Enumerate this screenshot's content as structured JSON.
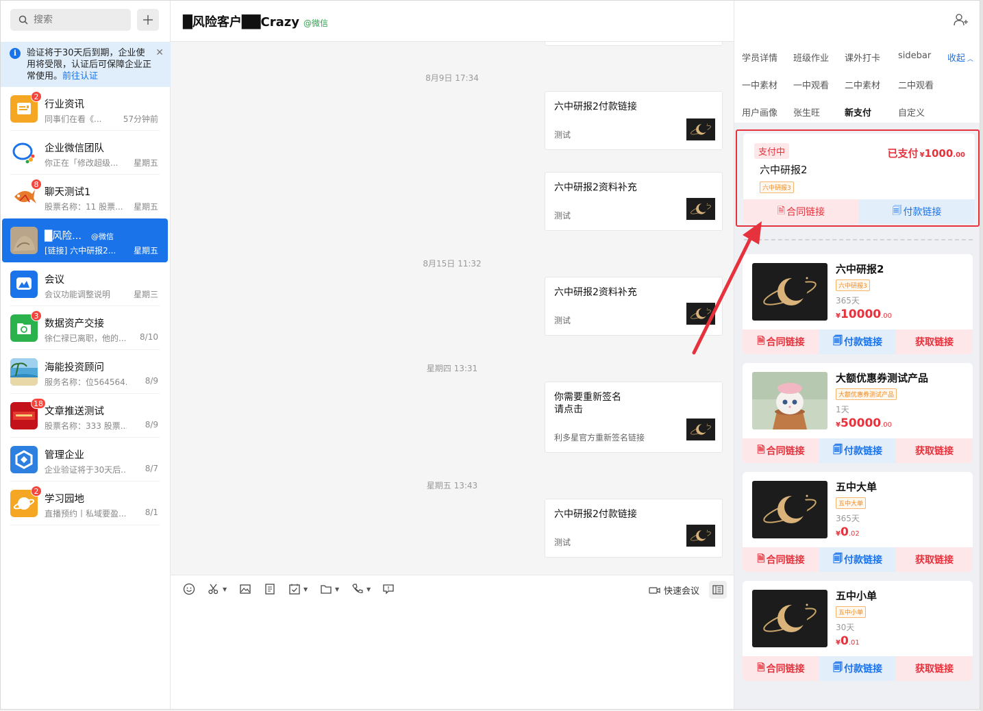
{
  "search": {
    "placeholder": "搜索"
  },
  "notice": {
    "text": "验证将于30天后到期，企业使用将受限，认证后可保障企业正常使用。",
    "link": "前往认证"
  },
  "conversations": [
    {
      "name": "行业资讯",
      "preview": "同事们在看《...",
      "time": "57分钟前",
      "badge": "2",
      "avatar": "news"
    },
    {
      "name": "企业微信团队",
      "preview": "你正在「修改超级...",
      "time": "星期五",
      "badge": "",
      "avatar": "wecom"
    },
    {
      "name": "聊天测试1",
      "preview": "股票名称：11 股票...",
      "time": "星期五",
      "badge": "8",
      "avatar": "fish"
    },
    {
      "name": "█风险...",
      "tag": "@微信",
      "preview": "[链接] 六中研报2...",
      "time": "星期五",
      "badge": "",
      "avatar": "photo"
    },
    {
      "name": "会议",
      "preview": "会议功能调整说明",
      "time": "星期三",
      "badge": "",
      "avatar": "meeting"
    },
    {
      "name": "数据资产交接",
      "preview": "徐仁禄已离职，他的...",
      "time": "8/10",
      "badge": "3",
      "avatar": "data"
    },
    {
      "name": "海能投资顾问",
      "preview": "服务名称：位564564...",
      "time": "8/9",
      "badge": "",
      "avatar": "beach"
    },
    {
      "name": "文章推送测试",
      "preview": "股票名称：333 股票...",
      "time": "8/9",
      "badge": "18",
      "avatar": "red"
    },
    {
      "name": "管理企业",
      "preview": "企业验证将于30天后...",
      "time": "8/7",
      "badge": "",
      "avatar": "manage"
    },
    {
      "name": "学习园地",
      "preview": "直播预约丨私域要盈...",
      "time": "8/1",
      "badge": "2",
      "avatar": "study"
    }
  ],
  "chat": {
    "title": "█风险客户██Crazy",
    "title_tag": "@微信",
    "timestamps": [
      "8月9日 17:34",
      "8月15日 11:32",
      "星期四 13:31",
      "星期五 13:43"
    ],
    "cards": [
      {
        "title": "六中研报2付款链接",
        "desc": "测试"
      },
      {
        "title": "六中研报2资料补充",
        "desc": "测试"
      },
      {
        "title": "六中研报2资料补充",
        "desc": "测试"
      },
      {
        "title": "你需要重新签名\n请点击",
        "desc": "利多星官方重新签名链接"
      },
      {
        "title": "六中研报2付款链接",
        "desc": "测试"
      }
    ],
    "quick_meeting": "快速会议"
  },
  "sidebar_tabs": {
    "row1": [
      "学员详情",
      "班级作业",
      "课外打卡",
      "sidebar"
    ],
    "collapse": "收起",
    "row2": [
      "一中素材",
      "一中观看",
      "二中素材",
      "二中观看"
    ],
    "row3": [
      "用户画像",
      "张生旺",
      "新支付",
      "自定义"
    ],
    "active": "新支付"
  },
  "current_order": {
    "status": "支付中",
    "product": "六中研报2",
    "tag": "六中研报3",
    "paid_label": "已支付",
    "currency": "¥",
    "amount_int": "1000",
    "amount_dec": ".00",
    "contract_btn": "合同链接",
    "pay_btn": "付款链接"
  },
  "products": [
    {
      "name": "六中研报2",
      "tag": "六中研报3",
      "duration": "365天",
      "price_int": "10000",
      "price_dec": ".00",
      "image": "logo"
    },
    {
      "name": "大额优惠券测试产品",
      "tag": "大额优惠券测试产品",
      "duration": "1天",
      "price_int": "50000",
      "price_dec": ".00",
      "image": "cat"
    },
    {
      "name": "五中大单",
      "tag": "五中大单",
      "duration": "365天",
      "price_int": "0",
      "price_dec": ".02",
      "image": "logo"
    },
    {
      "name": "五中小单",
      "tag": "五中小单",
      "duration": "30天",
      "price_int": "0",
      "price_dec": ".01",
      "image": "logo"
    }
  ],
  "product_buttons": {
    "contract": "合同链接",
    "pay": "付款链接",
    "get": "获取链接"
  },
  "colors": {
    "accent": "#1a73e8",
    "danger": "#e5323d",
    "wechat_green": "#2aa24a",
    "badge": "#f5453d"
  }
}
